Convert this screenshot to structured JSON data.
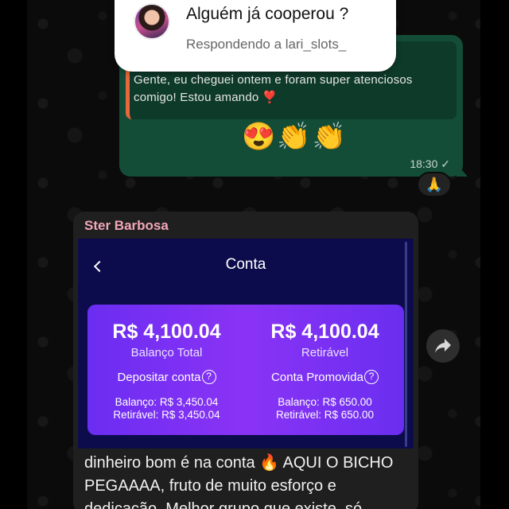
{
  "story_reply": {
    "title": "Alguém já cooperou ?",
    "subtitle": "Respondendo a lari_slots_"
  },
  "outgoing": {
    "quoted_text": "Gente, eu cheguei ontem e foram super atenciosos comigo! Estou amando ❣️",
    "emojis": "😍👏👏",
    "time": "18:30",
    "status": "✓",
    "reaction": "🙏"
  },
  "incoming": {
    "sender": "Ster Barbosa",
    "screenshot": {
      "title": "Conta",
      "left": {
        "amount": "R$ 4,100.04",
        "label": "Balanço Total",
        "link": "Depositar conta",
        "line1": "Balanço: R$ 3,450.04",
        "line2": "Retirável: R$ 3,450.04"
      },
      "right": {
        "amount": "R$ 4,100.04",
        "label": "Retirável",
        "link": "Conta Promovida",
        "line1": "Balanço: R$ 650.00",
        "line2": "Retirável: R$ 650.00"
      }
    },
    "text": "dinheiro bom é na conta 🔥 AQUI O BICHO PEGAAAA, fruto de muito esforço e dedicação. Melhor grupo que existe, só"
  }
}
